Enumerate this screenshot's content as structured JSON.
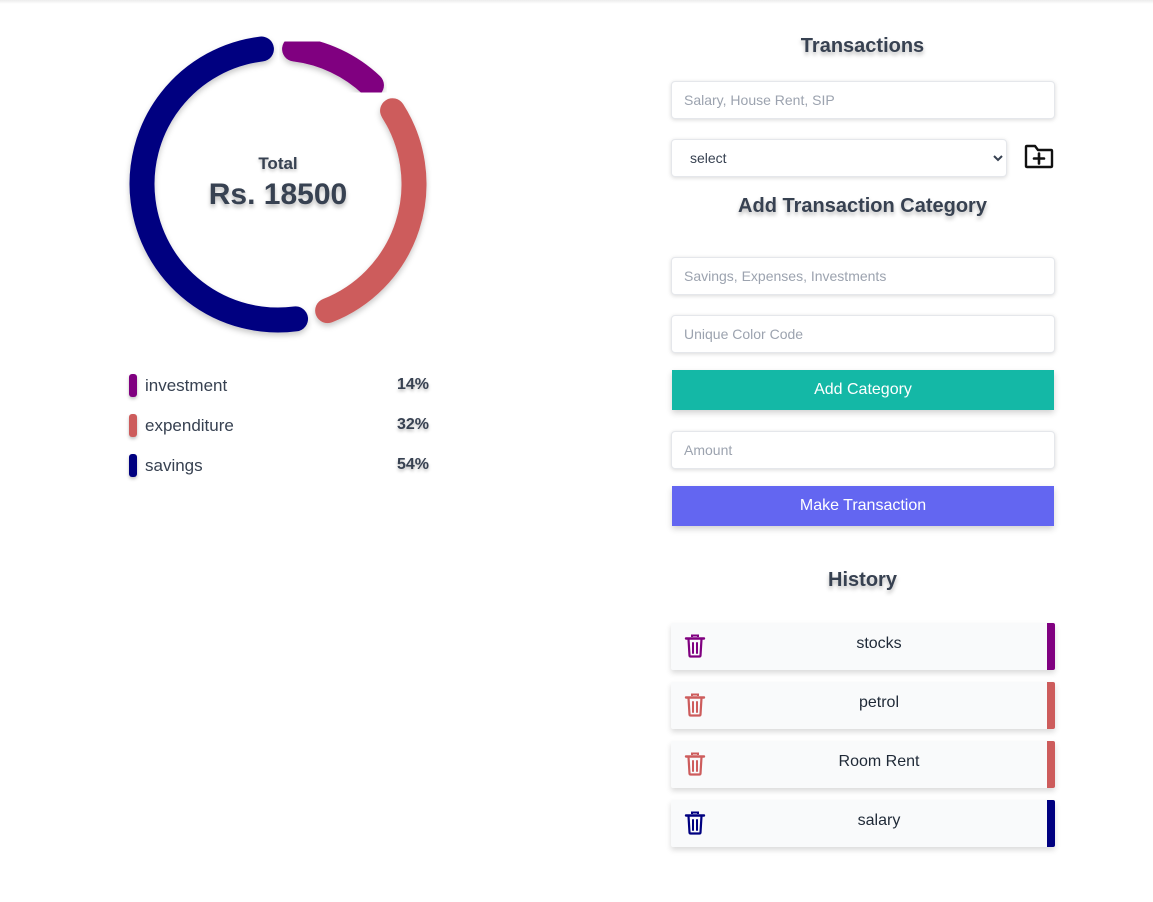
{
  "summary": {
    "total_label": "Total",
    "total_value": "Rs. 18500"
  },
  "chart_data": {
    "type": "pie",
    "variant": "doughnut",
    "total": 18500,
    "series": [
      {
        "name": "investment",
        "value": 14,
        "label": "14%",
        "color": "#800080"
      },
      {
        "name": "expenditure",
        "value": 32,
        "label": "32%",
        "color": "#cd5c5c"
      },
      {
        "name": "savings",
        "value": 54,
        "label": "54%",
        "color": "#000080"
      }
    ]
  },
  "transactions": {
    "heading": "Transactions",
    "name_placeholder": "Salary, House Rent, SIP",
    "type_select_value": "select",
    "add_category_icon": "folder-plus-icon"
  },
  "category": {
    "heading": "Add Transaction Category",
    "name_placeholder": "Savings, Expenses, Investments",
    "color_placeholder": "Unique Color Code",
    "button_label": "Add Category",
    "button_color": "#14b8a6"
  },
  "amount": {
    "placeholder": "Amount",
    "button_label": "Make Transaction",
    "button_color": "#6366f1"
  },
  "history": {
    "heading": "History",
    "delete_icon": "trash-icon",
    "items": [
      {
        "name": "stocks",
        "color": "#800080"
      },
      {
        "name": "petrol",
        "color": "#cd5c5c"
      },
      {
        "name": "Room Rent",
        "color": "#cd5c5c"
      },
      {
        "name": "salary",
        "color": "#000080"
      }
    ]
  }
}
